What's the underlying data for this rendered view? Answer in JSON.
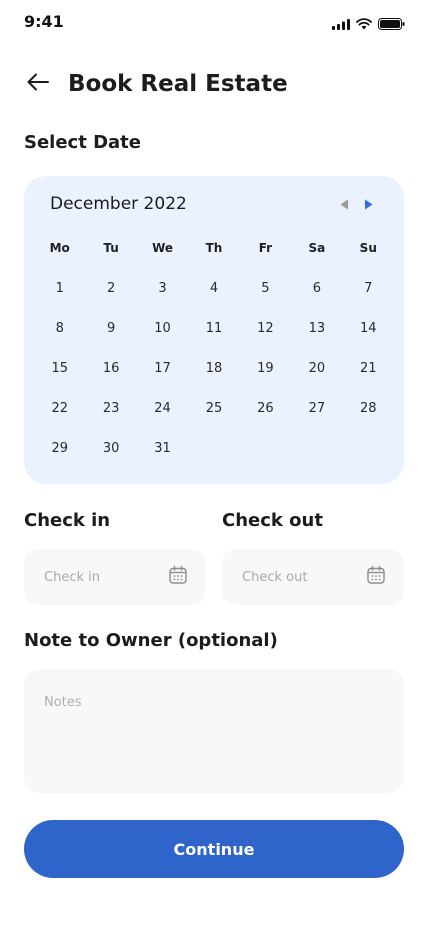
{
  "status_bar": {
    "time": "9:41"
  },
  "header": {
    "title": "Book Real Estate"
  },
  "select_date": {
    "label": "Select Date"
  },
  "calendar": {
    "month": "December 2022",
    "weekdays": [
      "Mo",
      "Tu",
      "We",
      "Th",
      "Fr",
      "Sa",
      "Su"
    ],
    "days": [
      "1",
      "2",
      "3",
      "4",
      "5",
      "6",
      "7",
      "8",
      "9",
      "10",
      "11",
      "12",
      "13",
      "14",
      "15",
      "16",
      "17",
      "18",
      "19",
      "20",
      "21",
      "22",
      "23",
      "24",
      "25",
      "26",
      "27",
      "28",
      "29",
      "30",
      "31"
    ]
  },
  "check_in": {
    "label": "Check in",
    "placeholder": "Check in"
  },
  "check_out": {
    "label": "Check out",
    "placeholder": "Check out"
  },
  "note": {
    "label": "Note to Owner (optional)",
    "placeholder": "Notes"
  },
  "continue": {
    "label": "Continue"
  },
  "colors": {
    "accent": "#2f65cb",
    "calendar_bg": "#eaf1ff",
    "field_bg": "#f8f8f8",
    "nav_active": "#2f6fe6",
    "nav_inactive": "#9a9a9a"
  }
}
